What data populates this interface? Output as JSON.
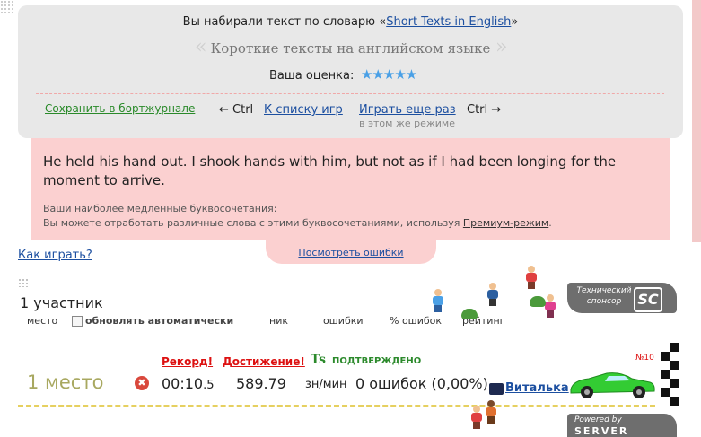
{
  "vocab": {
    "prefix": "Вы набирали текст по словарю «",
    "link": "Short Texts in English",
    "suffix": "»",
    "title": "Короткие тексты на английском языке",
    "quote_left": "«",
    "quote_right": "»"
  },
  "rating": {
    "label": "Ваша оценка:",
    "stars": "★★★★★",
    "value": 5,
    "max": 5
  },
  "actions": {
    "save_journal": "Сохранить в бортжурнале",
    "ctrl_left": "← Ctrl",
    "game_list": "К списку игр",
    "play_again": "Играть еще раз",
    "ctrl_right": "Ctrl →",
    "same_mode": "в этом же режиме"
  },
  "text_panel": {
    "typed_text": "He held his hand out. I shook hands with him, but not as if I had been longing for the moment to arrive.",
    "slow_title": "Ваши наиболее медленные буквосочетания:",
    "slow_desc_prefix": "Вы можете отработать различные слова с этими буквосочетаниями, используя ",
    "premium_link": "Премиум-режим",
    "slow_desc_suffix": ".",
    "view_errors": "Посмотреть ошибки"
  },
  "help": {
    "how_to_play": "Как играть?"
  },
  "table": {
    "participants": "1 участник",
    "headers": {
      "place": "место",
      "auto_update": "обновлять автоматически",
      "nick": "ник",
      "errors": "ошибки",
      "pct_errors": "% ошибок",
      "rating": "рейтинг"
    }
  },
  "sponsor": {
    "line1": "Технический",
    "line2": "спонсор",
    "logo": "SC",
    "powered_by": "Powered by",
    "server": "SERVER"
  },
  "result": {
    "record": "Рекорд!",
    "achievement": "Достижение!",
    "ts": "Ts",
    "verified": "ПОДТВЕРЖДЕНО",
    "place": "1 место",
    "x_mark": "✖",
    "time": "00:10",
    "time_fraction": ".5",
    "speed": "589.79",
    "speed_unit": "зн/мин",
    "errors": "0 ошибок (0,00%)",
    "user": "Виталька",
    "car_number": "№10"
  },
  "colors": {
    "panel_grey": "#e8e8e8",
    "panel_pink": "#fbd0d0",
    "link": "#1c4fa0",
    "green": "#2c8a2c",
    "record_red": "#d11",
    "car_green": "#33cc33",
    "stars": "#4aa0e6"
  }
}
